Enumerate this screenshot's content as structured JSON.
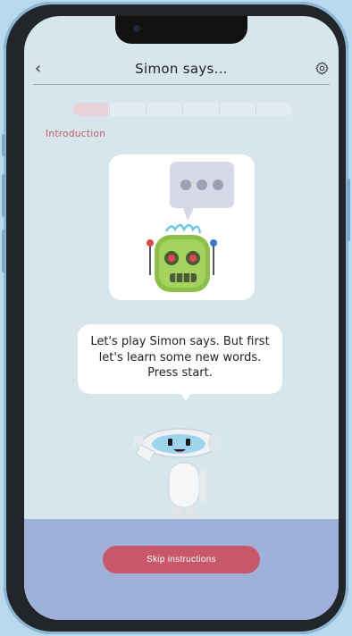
{
  "header": {
    "title": "Simon says...",
    "back_icon": "chevron-left-icon",
    "settings_icon": "gear-icon"
  },
  "progress": {
    "value": 0.16,
    "segments": 6
  },
  "section_label": "Introduction",
  "speech": {
    "text": "Let's play Simon says. But first let's learn some new words. Press start."
  },
  "footer": {
    "skip_label": "Skip instructions"
  },
  "colors": {
    "accent": "#c8576a",
    "screen_bg": "#d7e6ec",
    "footer_bg": "#9fb0d9"
  }
}
